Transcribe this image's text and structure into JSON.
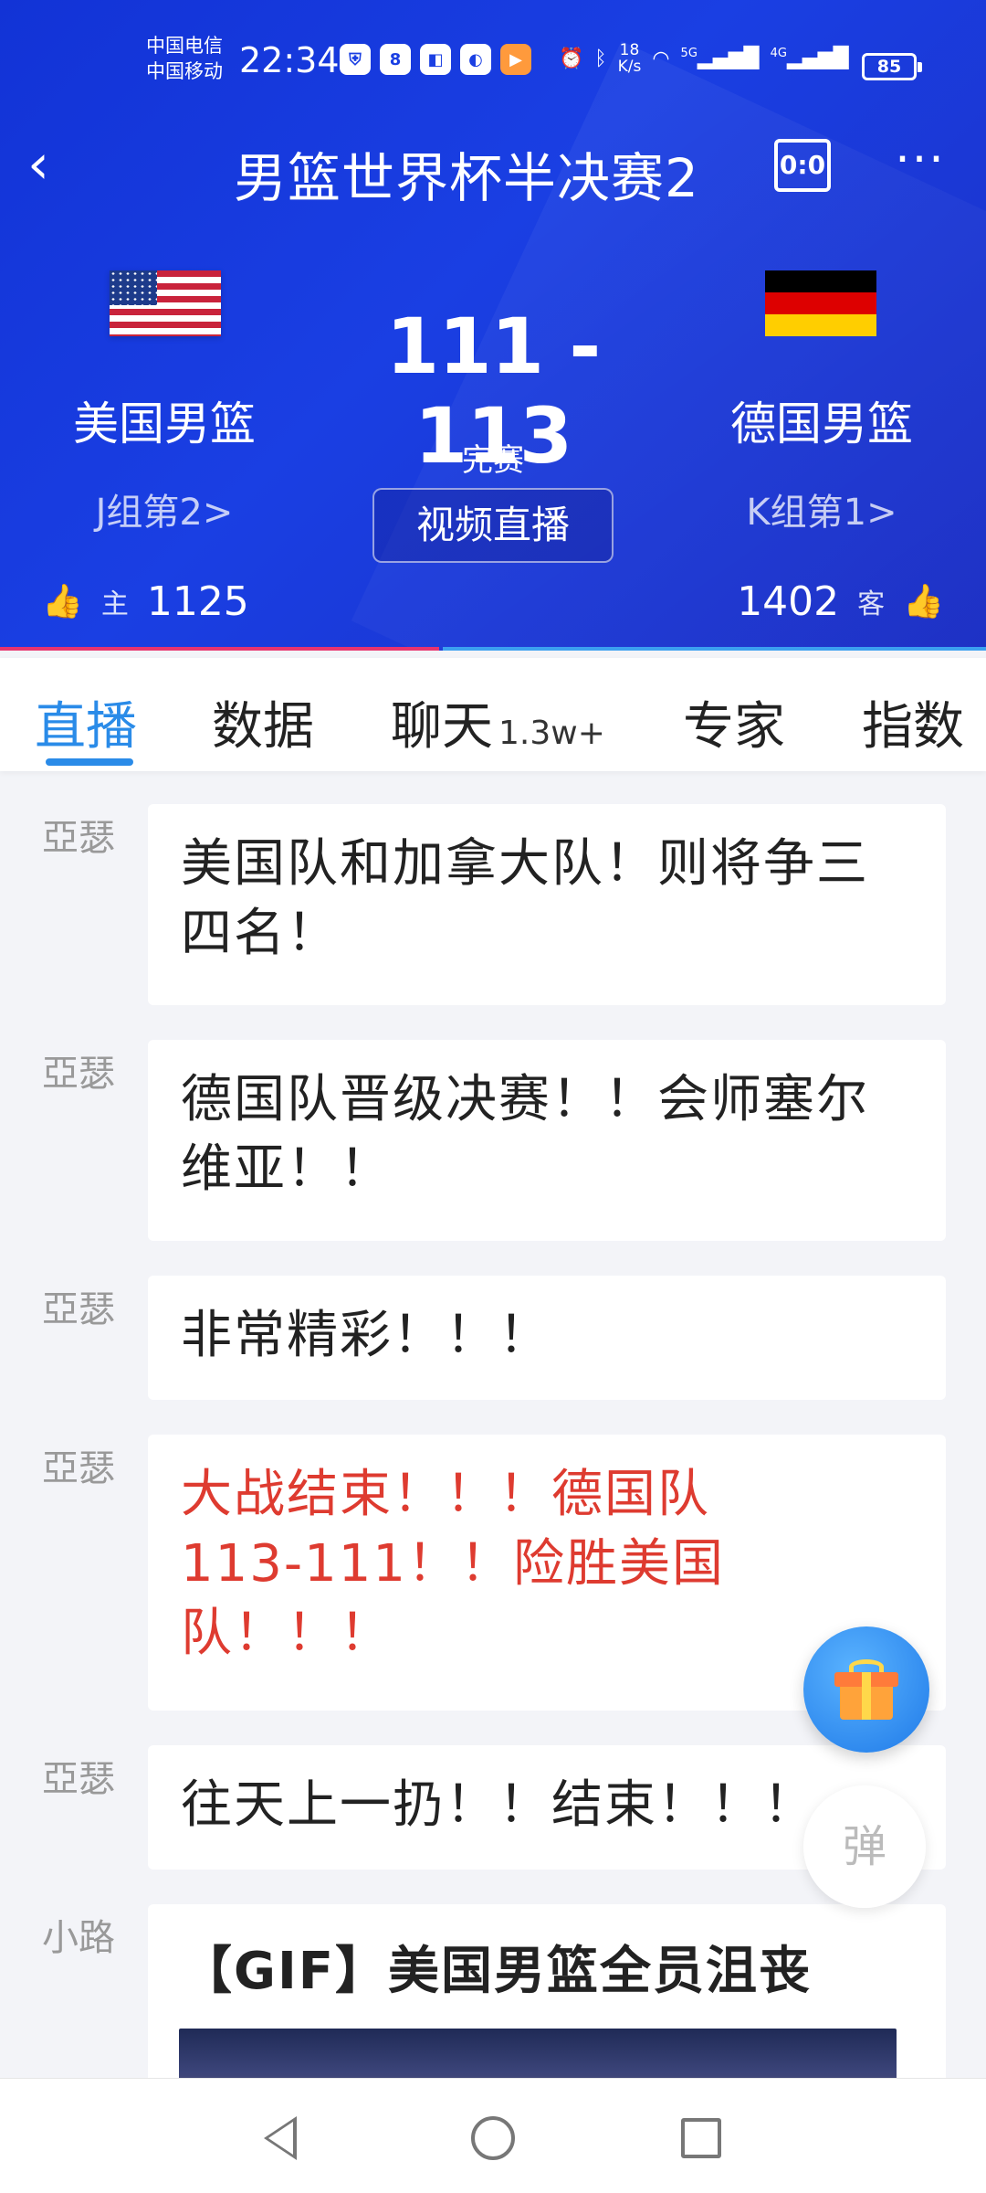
{
  "statusbar": {
    "carrier1": "中国电信",
    "carrier2": "中国移动",
    "time": "22:34",
    "net_speed_value": "18",
    "net_speed_unit": "K/s",
    "signal1": "5G",
    "signal2": "4G",
    "battery": "85"
  },
  "header": {
    "title": "男篮世界杯半决赛2",
    "scoreboard_icon_text": "0:0",
    "home_team": "美国男篮",
    "away_team": "德国男篮",
    "home_group": "J组第2>",
    "away_group": "K组第1>",
    "score": "111 - 113",
    "status": "完赛",
    "video_button": "视频直播",
    "home_tag": "主",
    "away_tag": "客",
    "home_votes": "1125",
    "away_votes": "1402",
    "home_vote_share": 0.445,
    "colors": {
      "home": "#e8336e",
      "away": "#3ba0f0",
      "header_bg": "#1a3fe3"
    }
  },
  "tabs": [
    {
      "label": "直播",
      "active": true
    },
    {
      "label": "数据"
    },
    {
      "label": "聊天",
      "sub": "1.3w+"
    },
    {
      "label": "专家"
    },
    {
      "label": "指数"
    }
  ],
  "feed": [
    {
      "author": "亞瑟",
      "text": "美国队和加拿大队！则将争三四名！"
    },
    {
      "author": "亞瑟",
      "text": "德国队晋级决赛！！会师塞尔维亚！！"
    },
    {
      "author": "亞瑟",
      "text": "非常精彩！！！"
    },
    {
      "author": "亞瑟",
      "text": "大战结束！！！德国队113-111！！险胜美国队！！！",
      "highlight": "#de3b30"
    },
    {
      "author": "亞瑟",
      "text": "往天上一扔！！结束！！！"
    },
    {
      "author": "小路",
      "text": "【GIF】美国男篮全员沮丧"
    }
  ],
  "floating": {
    "danmaku_label": "弹"
  }
}
